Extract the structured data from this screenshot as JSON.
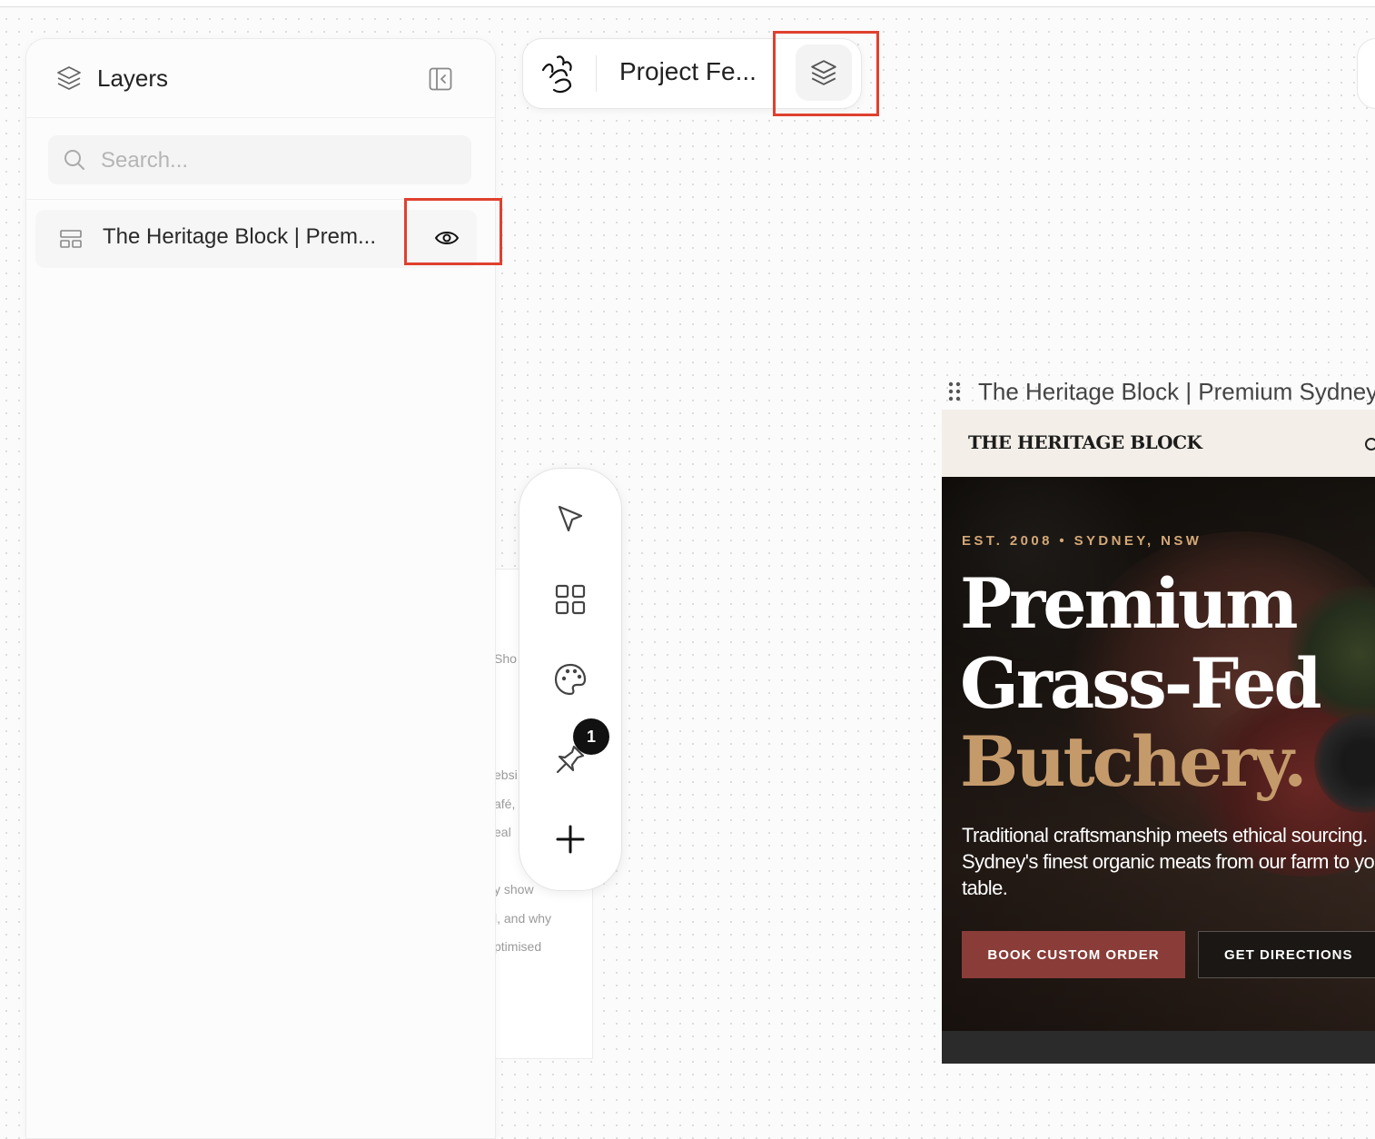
{
  "layers_panel": {
    "title": "Layers",
    "search_placeholder": "Search...",
    "items": [
      {
        "label": "The Heritage Block | Prem..."
      }
    ]
  },
  "project": {
    "name": "Project Fe..."
  },
  "toolbar": {
    "tools": [
      "select",
      "grid",
      "palette",
      "pin",
      "add"
    ],
    "pin_badge": "1"
  },
  "frame": {
    "title": "The Heritage Block | Premium Sydney",
    "site": {
      "logo": "THE HERITAGE BLOCK",
      "tagline": "EST. 2008 • SYDNEY, NSW",
      "headline_line1": "Premium",
      "headline_line2": "Grass-Fed",
      "headline_line3": "Butchery.",
      "subtext": "Traditional craftsmanship meets ethical sourcing. Sydney's finest organic meats from our farm to your table.",
      "primary_cta": "BOOK CUSTOM ORDER",
      "secondary_cta": "GET DIRECTIONS"
    }
  },
  "background_text": {
    "line1": "Sho",
    "line2": "ebsi",
    "line3": "afé,",
    "line4": "eal",
    "line5": "y show",
    "line6": "l, and why",
    "line7": "ptimised"
  },
  "colors": {
    "highlight": "#e0402f",
    "accent_gold": "#c59a6b",
    "primary_button": "#8a3d38",
    "tagline": "#d4a877"
  }
}
